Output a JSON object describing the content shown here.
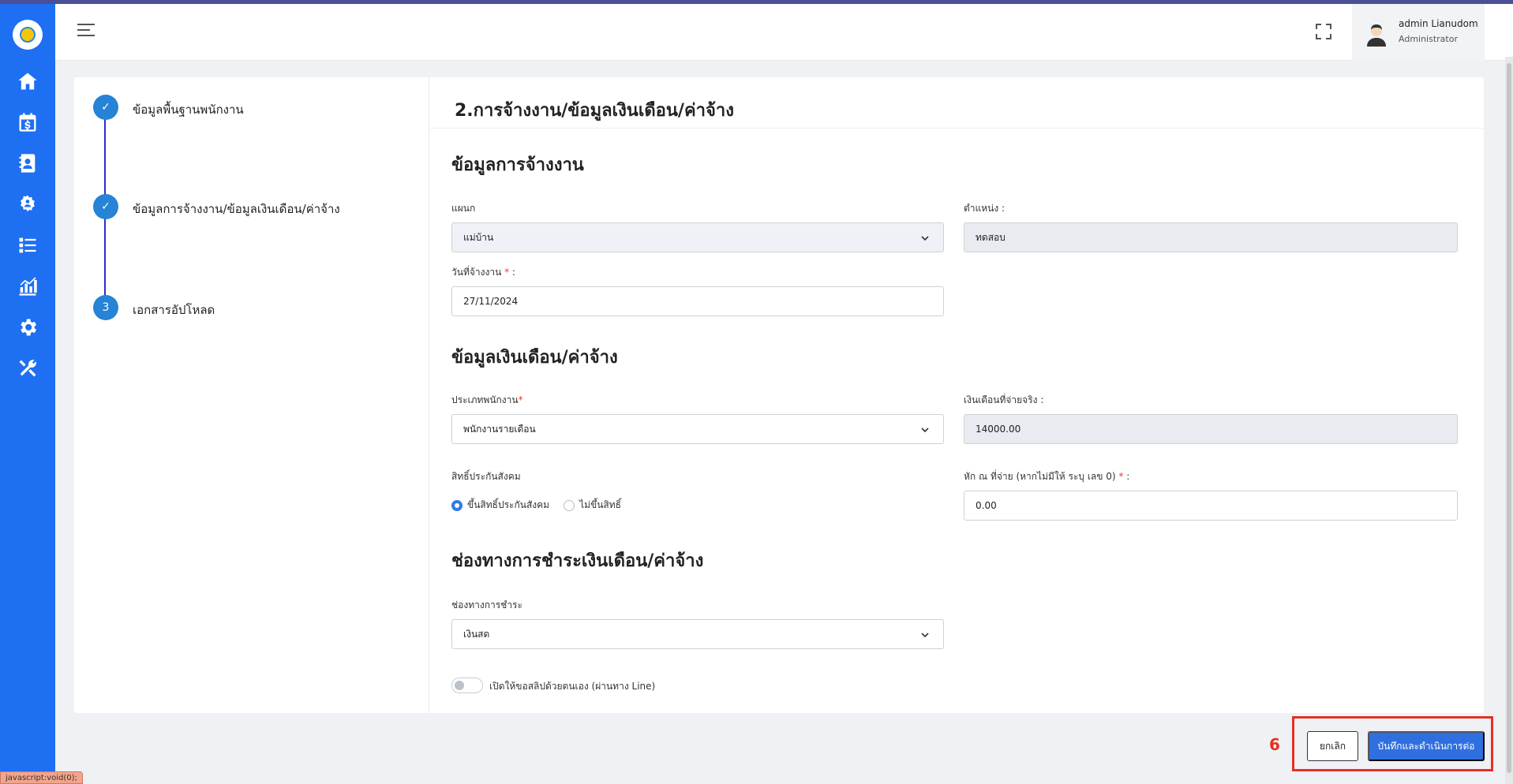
{
  "header": {
    "user_name": "admin Lianudom",
    "user_role": "Administrator"
  },
  "sidebar": {
    "items": [
      {
        "icon": "home-icon"
      },
      {
        "icon": "payroll-calendar-icon"
      },
      {
        "icon": "employee-contact-icon"
      },
      {
        "icon": "team-settings-icon"
      },
      {
        "icon": "task-list-icon"
      },
      {
        "icon": "report-chart-icon"
      },
      {
        "icon": "settings-gear-icon"
      },
      {
        "icon": "tools-icon"
      }
    ]
  },
  "steps": [
    {
      "label": "ข้อมูลพื้นฐานพนักงาน",
      "state": "completed",
      "marker": "✓"
    },
    {
      "label": "ข้อมูลการจ้างงาน/ข้อมูลเงินเดือน/ค่าจ้าง",
      "state": "completed",
      "marker": "✓"
    },
    {
      "label": "เอกสารอัปโหลด",
      "state": "pending",
      "marker": "3"
    }
  ],
  "form": {
    "title": "2.การจ้างงาน/ข้อมูลเงินเดือน/ค่าจ้าง",
    "employment": {
      "section_title": "ข้อมูลการจ้างงาน",
      "department_label": "แผนก",
      "department_value": "แม่บ้าน",
      "position_label": "ตำแหน่ง :",
      "position_value": "ทดสอบ",
      "hire_date_label": "วันที่จ้างงาน",
      "hire_date_required": "*",
      "hire_date_suffix": " :",
      "hire_date_value": "27/11/2024"
    },
    "salary": {
      "section_title": "ข้อมูลเงินเดือน/ค่าจ้าง",
      "employee_type_label": "ประเภทพนักงาน",
      "employee_type_required": "*",
      "employee_type_value": "พนักงานรายเดือน",
      "actual_salary_label": "เงินเดือนที่จ่ายจริง :",
      "actual_salary_value": "14000.00",
      "social_security_label": "สิทธิ์ประกันสังคม",
      "social_security_options": [
        "ขึ้นสิทธิ์ประกันสังคม",
        "ไม่ขึ้นสิทธิ์"
      ],
      "social_security_selected": "ขึ้นสิทธิ์ประกันสังคม",
      "withholding_label": "หัก ณ ที่จ่าย (หากไม่มีให้ ระบุ เลข 0)",
      "withholding_required": "*",
      "withholding_suffix": " :",
      "withholding_value": "0.00"
    },
    "payment": {
      "section_title": "ช่องทางการชำระเงินเดือน/ค่าจ้าง",
      "channel_label": "ช่องทางการชำระ",
      "channel_value": "เงินสด",
      "self_slip_toggle_label": "เปิดให้ขอสลิปด้วยตนเอง (ผ่านทาง Line)",
      "self_slip_enabled": false
    }
  },
  "footer": {
    "step_number": "6",
    "cancel_label": "ยกเลิก",
    "save_label": "บันทึกและดำเนินการต่อ"
  },
  "status_bar": {
    "link_preview": "javascript:void(0);"
  },
  "colors": {
    "sidebar": "#1e6ff2",
    "primary": "#2f6fe0",
    "step": "#2683d6",
    "highlight": "#e53022"
  }
}
